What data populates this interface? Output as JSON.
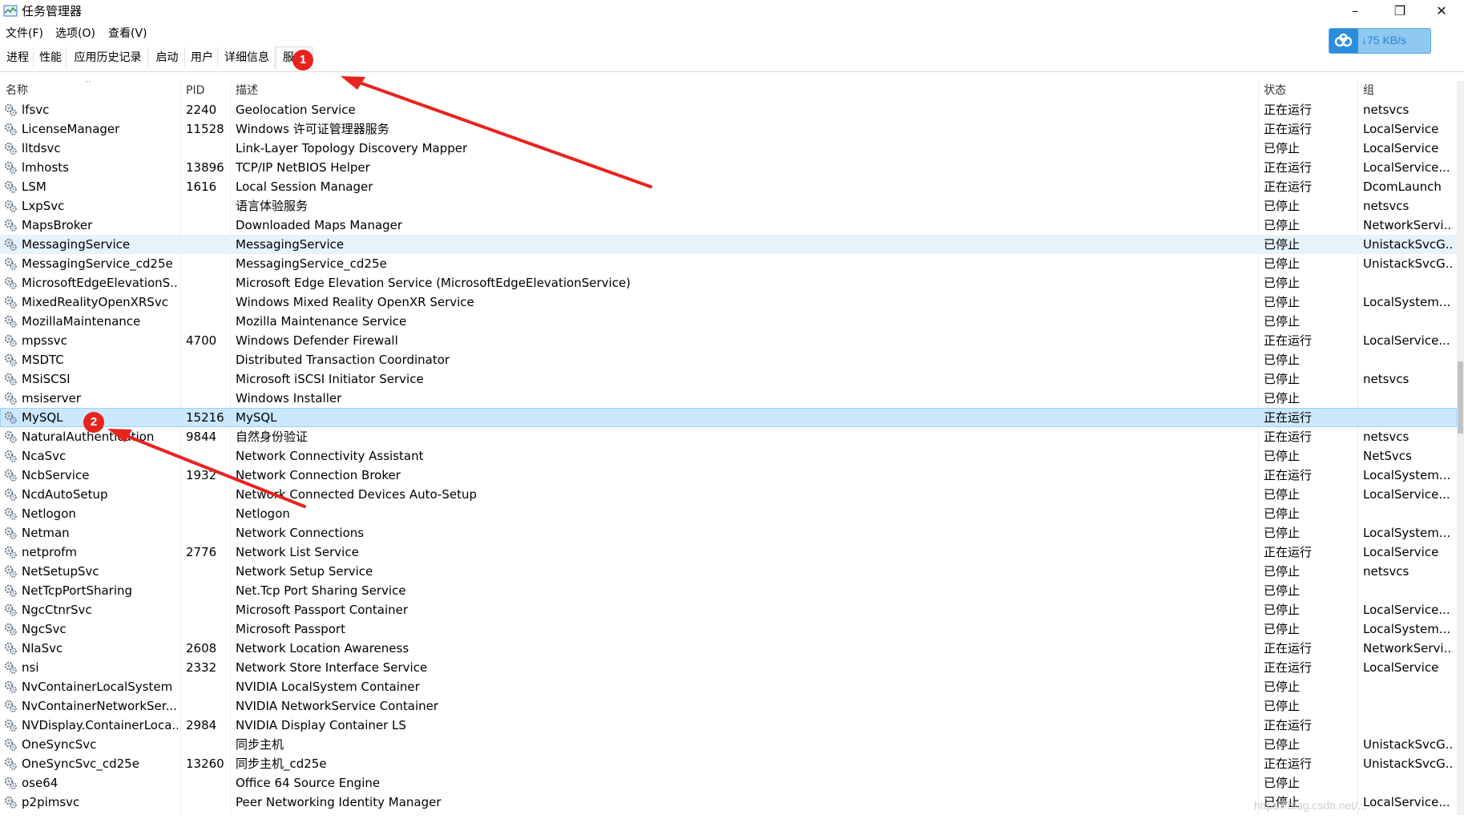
{
  "window": {
    "title": "任务管理器",
    "controls": {
      "minimize": "–",
      "maximize": "❐",
      "close": "✕"
    }
  },
  "menu": [
    "文件(F)",
    "选项(O)",
    "查看(V)"
  ],
  "tabs": [
    {
      "label": "进程"
    },
    {
      "label": "性能"
    },
    {
      "label": "应用历史记录"
    },
    {
      "label": "启动"
    },
    {
      "label": "用户"
    },
    {
      "label": "详细信息"
    },
    {
      "label": "服务",
      "active": true
    }
  ],
  "speed_widget": {
    "text": "↓75 KB/s",
    "accent": "#2a8ee0"
  },
  "table": {
    "columns": [
      "名称",
      "PID",
      "描述",
      "状态",
      "组"
    ],
    "rows": [
      {
        "name": "lfsvc",
        "pid": "2240",
        "desc": "Geolocation Service",
        "status": "正在运行",
        "group": "netsvcs"
      },
      {
        "name": "LicenseManager",
        "pid": "11528",
        "desc": "Windows 许可证管理器服务",
        "status": "正在运行",
        "group": "LocalService"
      },
      {
        "name": "lltdsvc",
        "pid": "",
        "desc": "Link-Layer Topology Discovery Mapper",
        "status": "已停止",
        "group": "LocalService"
      },
      {
        "name": "lmhosts",
        "pid": "13896",
        "desc": "TCP/IP NetBIOS Helper",
        "status": "正在运行",
        "group": "LocalService..."
      },
      {
        "name": "LSM",
        "pid": "1616",
        "desc": "Local Session Manager",
        "status": "正在运行",
        "group": "DcomLaunch"
      },
      {
        "name": "LxpSvc",
        "pid": "",
        "desc": "语言体验服务",
        "status": "已停止",
        "group": "netsvcs"
      },
      {
        "name": "MapsBroker",
        "pid": "",
        "desc": "Downloaded Maps Manager",
        "status": "已停止",
        "group": "NetworkServi..."
      },
      {
        "name": "MessagingService",
        "pid": "",
        "desc": "MessagingService",
        "status": "已停止",
        "group": "UnistackSvcG...",
        "state": "hover"
      },
      {
        "name": "MessagingService_cd25e",
        "pid": "",
        "desc": "MessagingService_cd25e",
        "status": "已停止",
        "group": "UnistackSvcG..."
      },
      {
        "name": "MicrosoftEdgeElevationS...",
        "pid": "",
        "desc": "Microsoft Edge Elevation Service (MicrosoftEdgeElevationService)",
        "status": "已停止",
        "group": ""
      },
      {
        "name": "MixedRealityOpenXRSvc",
        "pid": "",
        "desc": "Windows Mixed Reality OpenXR Service",
        "status": "已停止",
        "group": "LocalSystem..."
      },
      {
        "name": "MozillaMaintenance",
        "pid": "",
        "desc": "Mozilla Maintenance Service",
        "status": "已停止",
        "group": ""
      },
      {
        "name": "mpssvc",
        "pid": "4700",
        "desc": "Windows Defender Firewall",
        "status": "正在运行",
        "group": "LocalService..."
      },
      {
        "name": "MSDTC",
        "pid": "",
        "desc": "Distributed Transaction Coordinator",
        "status": "已停止",
        "group": ""
      },
      {
        "name": "MSiSCSI",
        "pid": "",
        "desc": "Microsoft iSCSI Initiator Service",
        "status": "已停止",
        "group": "netsvcs"
      },
      {
        "name": "msiserver",
        "pid": "",
        "desc": "Windows Installer",
        "status": "已停止",
        "group": ""
      },
      {
        "name": "MySQL",
        "pid": "15216",
        "desc": "MySQL",
        "status": "正在运行",
        "group": "",
        "state": "selected"
      },
      {
        "name": "NaturalAuthentication",
        "pid": "9844",
        "desc": "自然身份验证",
        "status": "正在运行",
        "group": "netsvcs"
      },
      {
        "name": "NcaSvc",
        "pid": "",
        "desc": "Network Connectivity Assistant",
        "status": "已停止",
        "group": "NetSvcs"
      },
      {
        "name": "NcbService",
        "pid": "1932",
        "desc": "Network Connection Broker",
        "status": "正在运行",
        "group": "LocalSystem..."
      },
      {
        "name": "NcdAutoSetup",
        "pid": "",
        "desc": "Network Connected Devices Auto-Setup",
        "status": "已停止",
        "group": "LocalService..."
      },
      {
        "name": "Netlogon",
        "pid": "",
        "desc": "Netlogon",
        "status": "已停止",
        "group": ""
      },
      {
        "name": "Netman",
        "pid": "",
        "desc": "Network Connections",
        "status": "已停止",
        "group": "LocalSystem..."
      },
      {
        "name": "netprofm",
        "pid": "2776",
        "desc": "Network List Service",
        "status": "正在运行",
        "group": "LocalService"
      },
      {
        "name": "NetSetupSvc",
        "pid": "",
        "desc": "Network Setup Service",
        "status": "已停止",
        "group": "netsvcs"
      },
      {
        "name": "NetTcpPortSharing",
        "pid": "",
        "desc": "Net.Tcp Port Sharing Service",
        "status": "已停止",
        "group": ""
      },
      {
        "name": "NgcCtnrSvc",
        "pid": "",
        "desc": "Microsoft Passport Container",
        "status": "已停止",
        "group": "LocalService..."
      },
      {
        "name": "NgcSvc",
        "pid": "",
        "desc": "Microsoft Passport",
        "status": "已停止",
        "group": "LocalSystem..."
      },
      {
        "name": "NlaSvc",
        "pid": "2608",
        "desc": "Network Location Awareness",
        "status": "正在运行",
        "group": "NetworkServi..."
      },
      {
        "name": "nsi",
        "pid": "2332",
        "desc": "Network Store Interface Service",
        "status": "正在运行",
        "group": "LocalService"
      },
      {
        "name": "NvContainerLocalSystem",
        "pid": "",
        "desc": "NVIDIA LocalSystem Container",
        "status": "已停止",
        "group": ""
      },
      {
        "name": "NvContainerNetworkSer...",
        "pid": "",
        "desc": "NVIDIA NetworkService Container",
        "status": "已停止",
        "group": ""
      },
      {
        "name": "NVDisplay.ContainerLoca...",
        "pid": "2984",
        "desc": "NVIDIA Display Container LS",
        "status": "正在运行",
        "group": ""
      },
      {
        "name": "OneSyncSvc",
        "pid": "",
        "desc": "同步主机",
        "status": "已停止",
        "group": "UnistackSvcG..."
      },
      {
        "name": "OneSyncSvc_cd25e",
        "pid": "13260",
        "desc": "同步主机_cd25e",
        "status": "正在运行",
        "group": "UnistackSvcG..."
      },
      {
        "name": "ose64",
        "pid": "",
        "desc": "Office 64 Source Engine",
        "status": "已停止",
        "group": ""
      },
      {
        "name": "p2pimsvc",
        "pid": "",
        "desc": "Peer Networking Identity Manager",
        "status": "已停止",
        "group": "LocalService..."
      }
    ]
  },
  "annotations": {
    "badge1": "1",
    "badge2": "2",
    "color": "#e8231e"
  },
  "watermark": "https://blog.csdn.net/..."
}
